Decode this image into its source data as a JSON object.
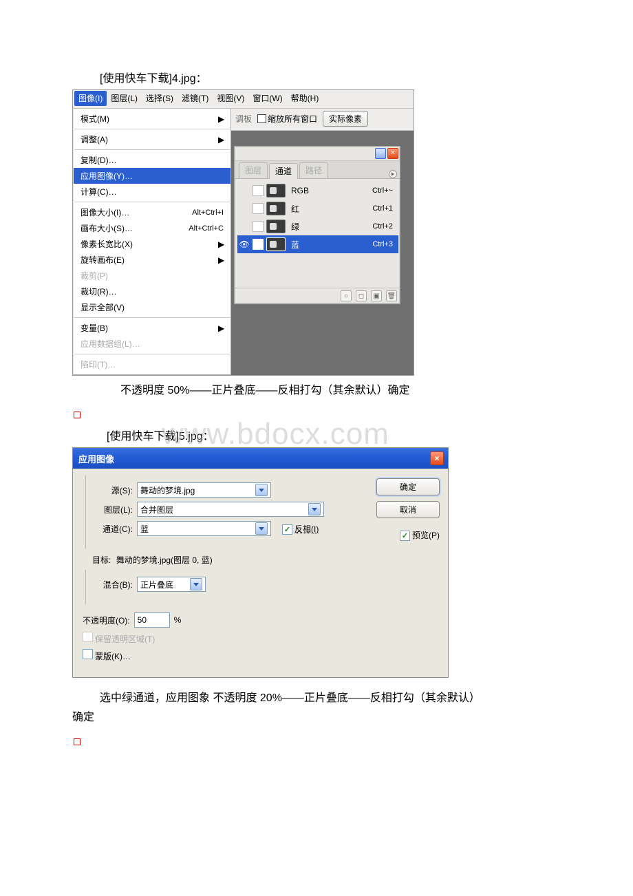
{
  "captions": {
    "image4": "[使用快车下载]4.jpg：",
    "image5": "[使用快车下载]5.jpg：",
    "paragraph1": "不透明度 50%——正片叠底——反相打勾（其余默认）确定",
    "paragraph2a": "选中绿通道，应用图象  不透明度 20%——正片叠底——反相打勾（其余默认）",
    "paragraph2b": "确定"
  },
  "watermark": "www.bdocx.com",
  "menubar": [
    "图像(I)",
    "图层(L)",
    "选择(S)",
    "滤镜(T)",
    "视图(V)",
    "窗口(W)",
    "帮助(H)"
  ],
  "image_menu": {
    "mode": "模式(M)",
    "adjust": "调整(A)",
    "duplicate": "复制(D)…",
    "apply": "应用图像(Y)…",
    "calc": "计算(C)…",
    "imagesize": "图像大小(I)…",
    "canvassize": "画布大小(S)…",
    "pixelratio": "像素长宽比(X)",
    "rotate": "旋转画布(E)",
    "crop": "裁剪(P)",
    "trim": "裁切(R)…",
    "revealall": "显示全部(V)",
    "variables": "变量(B)",
    "applydata": "应用数据组(L)…",
    "trap": "陷印(T)…",
    "sc_imagesize": "Alt+Ctrl+I",
    "sc_canvassize": "Alt+Ctrl+C"
  },
  "toolbar2": {
    "palette": "调板",
    "zoomall": "缩放所有窗口",
    "actual": "实际像素"
  },
  "channels_panel": {
    "tabs": {
      "layers": "图层",
      "channels": "通道",
      "paths": "路径"
    },
    "rows": [
      {
        "name": "RGB",
        "shortcut": "Ctrl+~"
      },
      {
        "name": "红",
        "shortcut": "Ctrl+1"
      },
      {
        "name": "绿",
        "shortcut": "Ctrl+2"
      },
      {
        "name": "蓝",
        "shortcut": "Ctrl+3"
      }
    ]
  },
  "dialog": {
    "title": "应用图像",
    "source_lbl": "源(S):",
    "source_val": "舞动的梦境.jpg",
    "layer_lbl": "图层(L):",
    "layer_val": "合并图层",
    "channel_lbl": "通道(C):",
    "channel_val": "蓝",
    "invert_lbl": "反相(I)",
    "target_lbl": "目标:",
    "target_val": "舞动的梦境.jpg(图层 0, 蓝)",
    "blend_lbl": "混合(B):",
    "blend_val": "正片叠底",
    "opacity_lbl": "不透明度(O):",
    "opacity_val": "50",
    "opacity_unit": "%",
    "preserve_lbl": "保留透明区域(T)",
    "mask_lbl": "蒙版(K)…",
    "ok": "确定",
    "cancel": "取消",
    "preview": "预览(P)"
  }
}
